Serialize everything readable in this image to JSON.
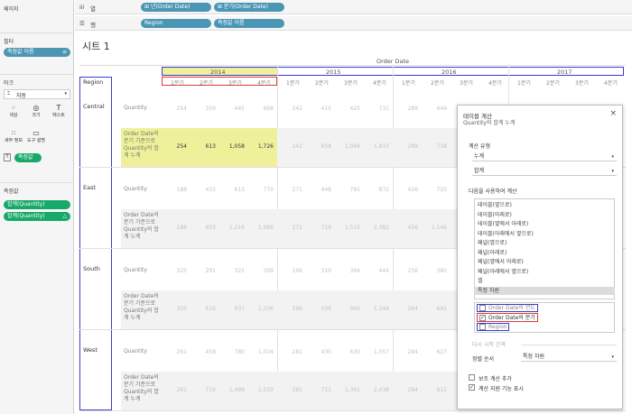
{
  "left_pane": {
    "pages_title": "페이지",
    "filters_title": "필터",
    "filter_pill": "측정값 이름",
    "marks_title": "마크",
    "marks_type": "자동",
    "mark_buttons": [
      "색상",
      "크기",
      "텍스트",
      "세부 정보",
      "도구 설명"
    ],
    "measure_pill": "측정값",
    "measure_values_title": "측정값",
    "measure_values": [
      "합계(Quantity)",
      "합계(Quantity)"
    ]
  },
  "shelves": {
    "columns_label": "열",
    "columns_pills": [
      "⊞ 년(Order Date)",
      "⊞ 분기(Order Date)"
    ],
    "rows_label": "행",
    "rows_pills": [
      "Region",
      "측정값 이름"
    ]
  },
  "sheet": {
    "title": "시트 1",
    "top_header": "Order Date",
    "region_header": "Region",
    "years": [
      "2014",
      "2015",
      "2016",
      "2017"
    ],
    "quarters": [
      "1분기",
      "2분기",
      "3분기",
      "4분기"
    ],
    "measure_quantity": "Quantity",
    "measure_running": "Order Date의 분기 기준으로 Quantity의 합계 누계",
    "regions": [
      {
        "name": "Central",
        "quantity": [
          "254",
          "359",
          "445",
          "668",
          "242",
          "415",
          "425",
          "731",
          "289",
          "449"
        ],
        "running": [
          "254",
          "613",
          "1,058",
          "1,726",
          "242",
          "658",
          "1,084",
          "1,815",
          "289",
          "738"
        ]
      },
      {
        "name": "East",
        "quantity": [
          "188",
          "415",
          "613",
          "770",
          "271",
          "448",
          "791",
          "872",
          "426",
          "720"
        ],
        "running": [
          "188",
          "603",
          "1,216",
          "1,986",
          "271",
          "719",
          "1,510",
          "2,382",
          "426",
          "1,146"
        ]
      },
      {
        "name": "South",
        "quantity": [
          "325",
          "291",
          "321",
          "399",
          "196",
          "310",
          "394",
          "444",
          "256",
          "380"
        ],
        "running": [
          "325",
          "616",
          "937",
          "1,336",
          "196",
          "506",
          "900",
          "1,344",
          "264",
          "642"
        ]
      },
      {
        "name": "West",
        "quantity": [
          "261",
          "458",
          "780",
          "1,034",
          "281",
          "430",
          "630",
          "1,057",
          "284",
          "627"
        ],
        "running": [
          "261",
          "719",
          "1,499",
          "2,533",
          "281",
          "711",
          "1,341",
          "2,438",
          "284",
          "911"
        ]
      }
    ]
  },
  "dialog": {
    "title": "테이블 계산",
    "subtitle": "Quantity의 합계 누계",
    "calc_type_label": "계산 유형",
    "calc_type_value": "누계",
    "aggregation_value": "합계",
    "compute_using_label": "다음을 사용하여 계산",
    "compute_options": [
      "테이블(옆으로)",
      "테이블(아래로)",
      "테이블(옆에서 아래로)",
      "테이블(아래에서 옆으로)",
      "패널(옆으로)",
      "패널(아래로)",
      "패널(옆에서 아래로)",
      "패널(아래에서 옆으로)",
      "셀",
      "특정 차원"
    ],
    "dimensions": [
      {
        "label": "Order Date의 연도",
        "checked": false
      },
      {
        "label": "Order Date의 분기",
        "checked": true
      },
      {
        "label": "Region",
        "checked": false
      }
    ],
    "restart_label": "다시 시작 간격",
    "sort_label": "정렬 순서",
    "sort_value": "특정 차원",
    "secondary_calc_label": "보조 계산 추가",
    "show_calc_assist_label": "계산 지원 기능 표시",
    "close_glyph": "×"
  }
}
